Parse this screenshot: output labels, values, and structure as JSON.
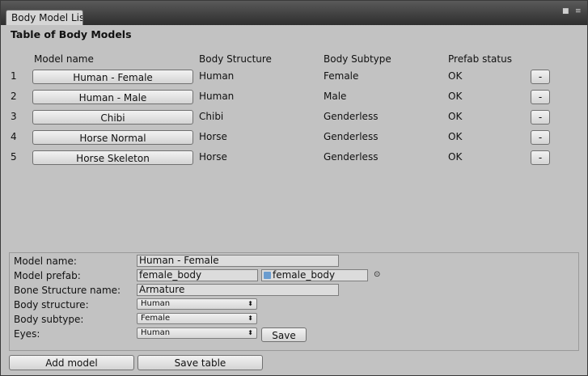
{
  "window": {
    "tab_title": "Body Model Lis",
    "menu_icon": "context-menu-icon",
    "maximize_icon": "maximize-icon"
  },
  "table": {
    "heading": "Table of Body Models",
    "columns": {
      "model_name": "Model name",
      "body_structure": "Body Structure",
      "body_subtype": "Body Subtype",
      "prefab_status": "Prefab status"
    },
    "rows": [
      {
        "index": "1",
        "model": "Human - Female",
        "structure": "Human",
        "subtype": "Female",
        "status": "OK",
        "remove": "-"
      },
      {
        "index": "2",
        "model": "Human - Male",
        "structure": "Human",
        "subtype": "Male",
        "status": "OK",
        "remove": "-"
      },
      {
        "index": "3",
        "model": "Chibi",
        "structure": "Chibi",
        "subtype": "Genderless",
        "status": "OK",
        "remove": "-"
      },
      {
        "index": "4",
        "model": "Horse Normal",
        "structure": "Horse",
        "subtype": "Genderless",
        "status": "OK",
        "remove": "-"
      },
      {
        "index": "5",
        "model": "Horse Skeleton",
        "structure": "Horse",
        "subtype": "Genderless",
        "status": "OK",
        "remove": "-"
      }
    ]
  },
  "editor": {
    "model_name_label": "Model name:",
    "model_name_value": "Human - Female",
    "model_prefab_label": "Model prefab:",
    "model_prefab_value": "female_body",
    "prefab_object_value": "female_body",
    "bone_structure_label": "Bone Structure name:",
    "bone_structure_value": "Armature",
    "body_structure_label": "Body structure:",
    "body_structure_value": "Human",
    "body_subtype_label": "Body subtype:",
    "body_subtype_value": "Female",
    "eyes_label": "Eyes:",
    "eyes_value": "Human",
    "save_label": "Save",
    "object_picker_icon": "object-picker-icon"
  },
  "footer": {
    "add_model_label": "Add model",
    "save_table_label": "Save table"
  }
}
